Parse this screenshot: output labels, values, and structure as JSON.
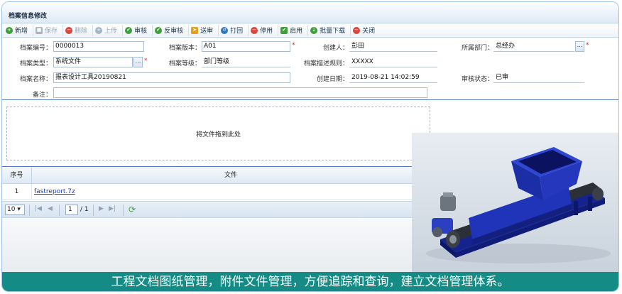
{
  "window": {
    "title": "档案信息修改"
  },
  "toolbar": {
    "buttons": [
      {
        "label": "新增"
      },
      {
        "label": "保存"
      },
      {
        "label": "删除"
      },
      {
        "label": "上传"
      },
      {
        "label": "审核"
      },
      {
        "label": "反审核"
      },
      {
        "label": "送审"
      },
      {
        "label": "打回"
      },
      {
        "label": "停用"
      },
      {
        "label": "启用"
      },
      {
        "label": "批量下载"
      },
      {
        "label": "关闭"
      }
    ]
  },
  "form": {
    "archive_no": {
      "label": "档案编号：",
      "value": "0000013"
    },
    "archive_version": {
      "label": "档案版本：",
      "value": "A01"
    },
    "creator": {
      "label": "创建人：",
      "value": "彭田"
    },
    "department": {
      "label": "所属部门：",
      "value": "总经办"
    },
    "archive_type": {
      "label": "档案类型：",
      "value": "系统文件"
    },
    "archive_level": {
      "label": "档案等级：",
      "value": "部门等级"
    },
    "desc_rule": {
      "label": "档案描述规则：",
      "value": "XXXXX"
    },
    "archive_name": {
      "label": "档案名称：",
      "value": "报表设计工具20190821"
    },
    "created_date": {
      "label": "创建日期：",
      "value": "2019-08-21 14:02:59"
    },
    "audit_status": {
      "label": "审核状态：",
      "value": "已审"
    },
    "remark": {
      "label": "备注：",
      "value": ""
    },
    "required_mark": "*",
    "lookup_label": "..."
  },
  "dropzone": {
    "text": "将文件拖到此处"
  },
  "grid": {
    "columns": [
      "序号",
      "文件"
    ],
    "rows": [
      {
        "no": "1",
        "file": "fastreport.7z"
      }
    ]
  },
  "pager": {
    "page_size": "10",
    "page": "1",
    "total": "/ 1"
  },
  "caption": {
    "text": "工程文档图纸管理，附件文件管理，方便追踪和查询，建立文档管理体系。"
  }
}
